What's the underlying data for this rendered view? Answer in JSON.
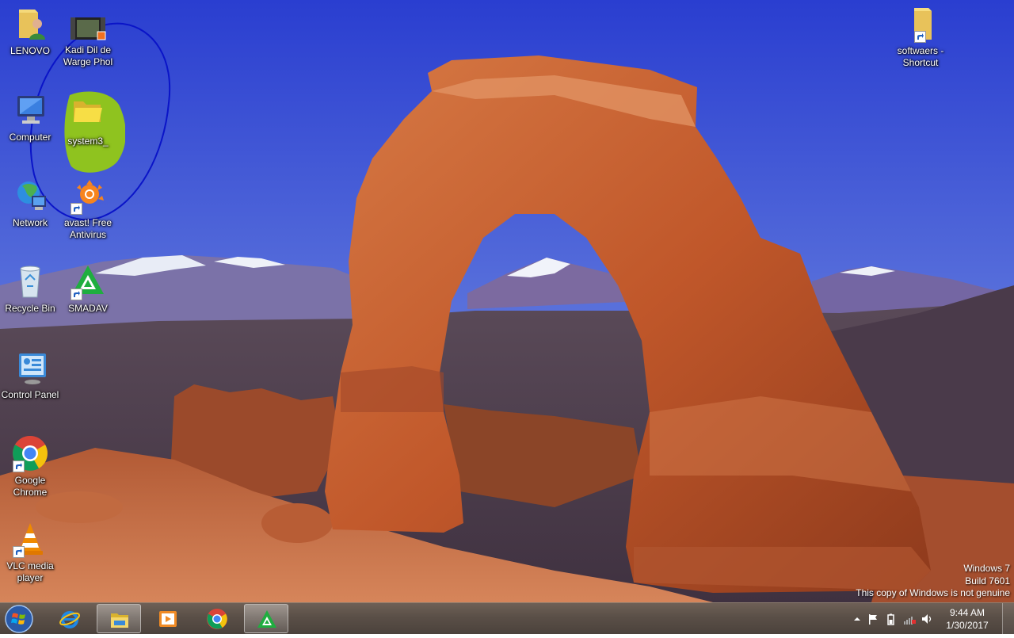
{
  "desktop": {
    "icons": [
      {
        "label": "LENOVO",
        "icon": "user-folder-icon"
      },
      {
        "label": "Kadi Dil de Warge Phol",
        "icon": "video-file-icon"
      },
      {
        "label": "Computer",
        "icon": "computer-icon"
      },
      {
        "label": "system3_",
        "icon": "folder-icon"
      },
      {
        "label": "Network",
        "icon": "network-icon"
      },
      {
        "label": "avast! Free Antivirus",
        "icon": "avast-icon"
      },
      {
        "label": "Recycle Bin",
        "icon": "recycle-bin-icon"
      },
      {
        "label": "SMADAV",
        "icon": "smadav-icon"
      },
      {
        "label": "Control Panel",
        "icon": "control-panel-icon"
      },
      {
        "label": "Google Chrome",
        "icon": "chrome-icon"
      },
      {
        "label": "VLC media player",
        "icon": "vlc-icon"
      },
      {
        "label": "softwaers - Shortcut",
        "icon": "folder-shortcut-icon"
      }
    ]
  },
  "watermark": {
    "line1": "Windows 7",
    "line2": "Build 7601",
    "line3": "This copy of Windows is not genuine"
  },
  "taskbar": {
    "pinned": [
      {
        "name": "internet-explorer",
        "icon": "ie-icon",
        "active": false
      },
      {
        "name": "windows-explorer",
        "icon": "explorer-icon",
        "active": true
      },
      {
        "name": "media-player",
        "icon": "media-player-icon",
        "active": false
      },
      {
        "name": "google-chrome",
        "icon": "chrome-icon",
        "active": false
      },
      {
        "name": "smadav",
        "icon": "smadav-icon",
        "active": true
      }
    ],
    "clock": {
      "time": "9:44 AM",
      "date": "1/30/2017"
    }
  },
  "colors": {
    "sky_top": "#2a3ed0",
    "sky_bottom": "#9fb1ec",
    "rock": "#c4602f",
    "taskbar": "#5a4f47",
    "annotation_circle": "#0a14c8",
    "annotation_highlight": "#8fc31f"
  }
}
